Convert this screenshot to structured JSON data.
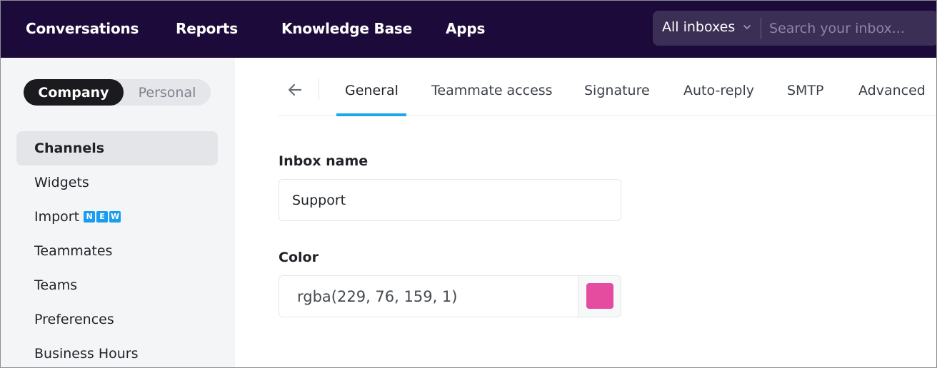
{
  "topnav": {
    "items": [
      "Conversations",
      "Reports",
      "Knowledge Base",
      "Apps"
    ],
    "inbox_select": "All inboxes",
    "search_placeholder": "Search your inbox..."
  },
  "sidebar": {
    "toggle": {
      "company": "Company",
      "personal": "Personal"
    },
    "items": [
      {
        "label": "Channels"
      },
      {
        "label": "Widgets"
      },
      {
        "label": "Import",
        "badge": [
          "N",
          "E",
          "W"
        ]
      },
      {
        "label": "Teammates"
      },
      {
        "label": "Teams"
      },
      {
        "label": "Preferences"
      },
      {
        "label": "Business Hours"
      }
    ]
  },
  "tabs": [
    "General",
    "Teammate access",
    "Signature",
    "Auto-reply",
    "SMTP",
    "Advanced"
  ],
  "form": {
    "inbox_name_label": "Inbox name",
    "inbox_name_value": "Support",
    "color_label": "Color",
    "color_value": "rgba(229, 76, 159, 1)",
    "swatch_color": "#e54c9f"
  },
  "colors": {
    "topbar": "#1c0b3a",
    "accent": "#1aa7ee"
  }
}
